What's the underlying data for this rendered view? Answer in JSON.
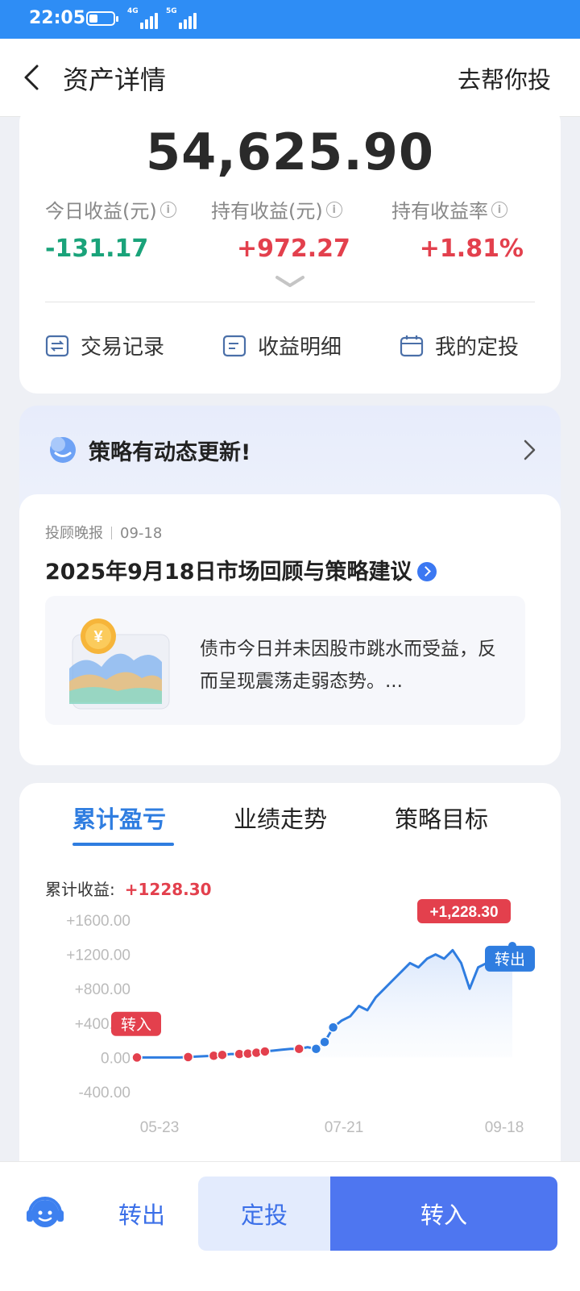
{
  "status_bar": {
    "time": "22:05",
    "net1": "4G",
    "net2": "5G"
  },
  "header": {
    "title": "资产详情",
    "right_link": "去帮你投"
  },
  "asset": {
    "total": "54,625.90",
    "metrics": [
      {
        "label": "今日收益(元)",
        "value": "-131.17"
      },
      {
        "label": "持有收益(元)",
        "value": "+972.27"
      },
      {
        "label": "持有收益率",
        "value": "+1.81%"
      }
    ],
    "actions": [
      "交易记录",
      "收益明细",
      "我的定投"
    ]
  },
  "strategy": {
    "banner": "策略有动态更新!",
    "report": {
      "source": "投顾晚报",
      "date": "09-18",
      "title": "2025年9月18日市场回顾与策略建议",
      "summary": "债市今日并未因股市跳水而受益，反而呈现震荡走弱态势。..."
    }
  },
  "tabs": [
    "累计盈亏",
    "业绩走势",
    "策略目标"
  ],
  "cumulative": {
    "label": "累计收益:",
    "value": "+1228.30"
  },
  "colors": {
    "accent": "#2f7de0",
    "up": "#e3404d",
    "down": "#1aa37a",
    "primary_btn": "#4e76f0"
  },
  "chart_data": {
    "type": "line",
    "yticks": [
      "+1600.00",
      "+1200.00",
      "+800.00",
      "+400.00",
      "0.00",
      "-400.00"
    ],
    "ylim": [
      -400,
      1600
    ],
    "xticks": [
      "05-23",
      "07-21",
      "09-18"
    ],
    "series": [
      {
        "values": [
          0,
          0,
          0,
          0,
          0,
          0,
          5,
          10,
          15,
          20,
          30,
          40,
          40,
          45,
          55,
          70,
          80,
          90,
          100,
          100,
          120,
          100,
          180,
          350,
          430,
          480,
          600,
          550,
          700,
          800,
          900,
          1000,
          1100,
          1050,
          1150,
          1200,
          1150,
          1250,
          1100,
          800,
          1050,
          1100,
          1200,
          1228.3,
          1300
        ]
      }
    ],
    "markers_buy": [
      0,
      14,
      21,
      23,
      27,
      29,
      31,
      35,
      44,
      50
    ],
    "markers_sell": [
      47,
      49,
      52
    ],
    "annotations": {
      "peak_label": "+1,228.30",
      "buy_tag": "转入",
      "sell_tag": "转出"
    }
  },
  "bottom_bar": {
    "transfer_out": "转出",
    "auto_invest": "定投",
    "transfer_in": "转入"
  }
}
